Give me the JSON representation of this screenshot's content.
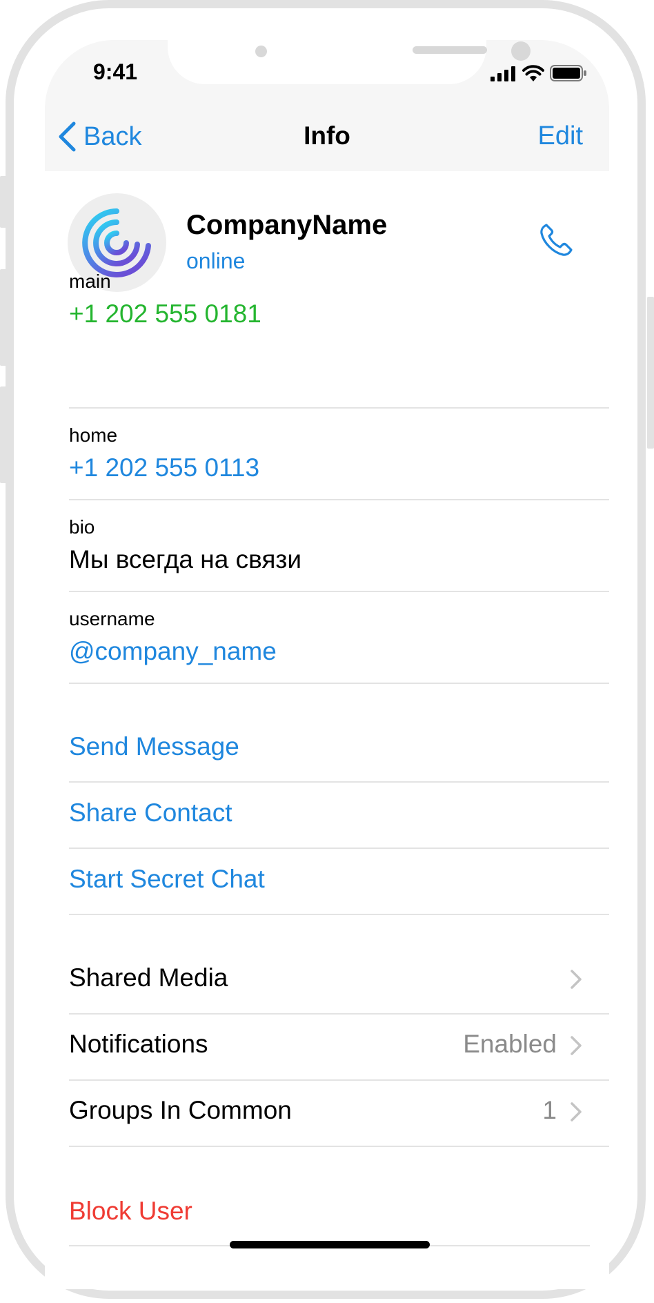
{
  "status": {
    "time": "9:41"
  },
  "nav": {
    "back": "Back",
    "title": "Info",
    "edit": "Edit"
  },
  "profile": {
    "name": "CompanyName",
    "status": "online"
  },
  "info": [
    {
      "label": "main",
      "value": "+1 202 555 0181"
    },
    {
      "label": "home",
      "value": "+1 202 555 0113"
    },
    {
      "label": "bio",
      "value": "Мы всегда на связи"
    },
    {
      "label": "username",
      "value": "@company_name"
    }
  ],
  "actions": [
    "Send Message",
    "Share Contact",
    "Start Secret Chat"
  ],
  "menu": [
    {
      "title": "Shared Media",
      "detail": ""
    },
    {
      "title": "Notifications",
      "detail": "Enabled"
    },
    {
      "title": "Groups In Common",
      "detail": "1"
    }
  ],
  "block": "Block User",
  "colors": {
    "accent": "#1f87de",
    "phone_main": "#24b52f",
    "danger": "#ef3b33",
    "detail": "#8a8a8a"
  }
}
